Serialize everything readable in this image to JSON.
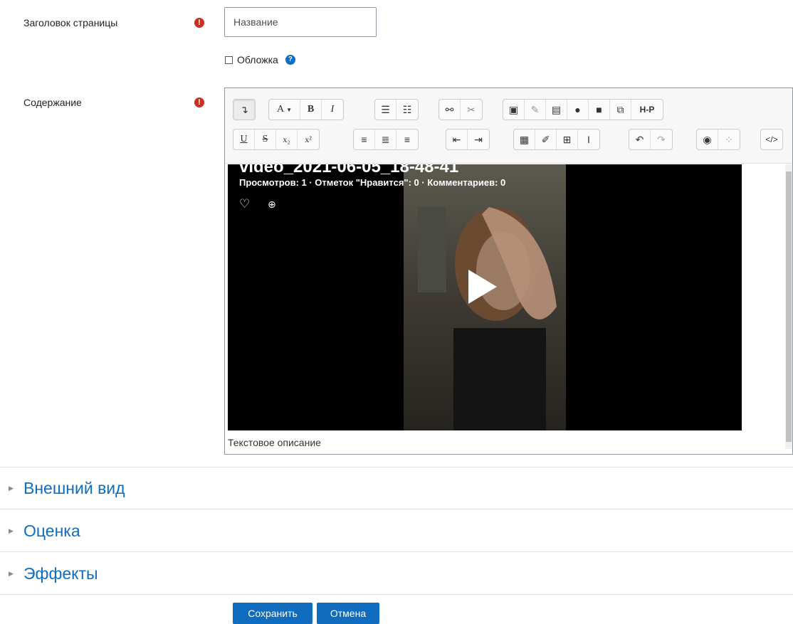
{
  "form": {
    "page_title": {
      "label": "Заголовок страницы",
      "value": "Название"
    },
    "cover": {
      "label": "Обложка",
      "checked": false
    },
    "content": {
      "label": "Содержание",
      "status_text": "Текстовое описание"
    }
  },
  "editor_toolbar": {
    "row1": [
      "collapse",
      "font-color",
      "bold",
      "italic",
      "unordered-list",
      "ordered-list",
      "link",
      "unlink",
      "image",
      "draw",
      "media",
      "record-audio",
      "record-video",
      "manage-files",
      "h5p"
    ],
    "row2": [
      "underline",
      "strikethrough",
      "subscript",
      "superscript",
      "align-left",
      "align-center",
      "align-right",
      "outdent",
      "indent",
      "equation",
      "special-character",
      "table",
      "clear-formatting",
      "undo",
      "redo",
      "accessibility-checker",
      "screen-reader-helper",
      "html-source"
    ],
    "labels": {
      "font": "A",
      "bold": "B",
      "italic": "I",
      "underline": "U",
      "strike": "S",
      "sub": "x₂",
      "sup": "x²",
      "h5p": "H-P"
    }
  },
  "video": {
    "title": "video_2021-06-05_18-48-41",
    "stats": "Просмотров: 1 · Отметок \"Нравится\": 0 · Комментариев: 0"
  },
  "sections": [
    {
      "title": "Внешний вид",
      "expanded": false
    },
    {
      "title": "Оценка",
      "expanded": false
    },
    {
      "title": "Эффекты",
      "expanded": false
    }
  ],
  "actions": {
    "save": "Сохранить",
    "cancel": "Отмена"
  },
  "colors": {
    "required": "#ca3120",
    "link": "#0f6cbf",
    "primary_button": "#0f6cbf"
  }
}
